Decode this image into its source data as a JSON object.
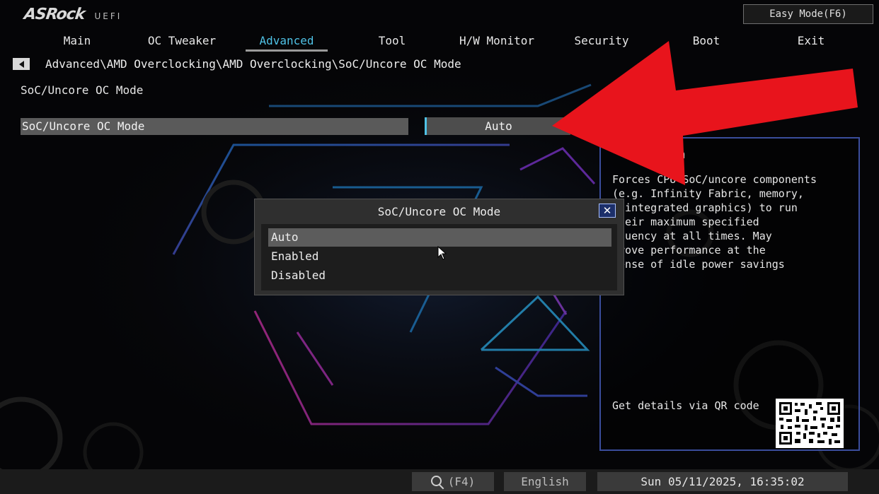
{
  "header": {
    "brand": "ASRock",
    "brand_suffix": "UEFI",
    "easy_mode_label": "Easy Mode(F6)"
  },
  "nav": {
    "items": [
      {
        "label": "Main"
      },
      {
        "label": "OC Tweaker"
      },
      {
        "label": "Advanced",
        "active": true
      },
      {
        "label": "Tool"
      },
      {
        "label": "H/W Monitor"
      },
      {
        "label": "Security"
      },
      {
        "label": "Boot"
      },
      {
        "label": "Exit"
      }
    ]
  },
  "breadcrumb": "Advanced\\AMD Overclocking\\AMD Overclocking\\SoC/Uncore OC Mode",
  "page_title": "SoC/Uncore OC Mode",
  "setting": {
    "label": "SoC/Uncore OC Mode",
    "value": "Auto"
  },
  "description": {
    "title": "tion",
    "lines": [
      "Forces CPU SoC/uncore components",
      "(e.g. Infinity Fabric, memory,",
      "d integrated graphics) to run",
      " their maximum specified",
      "equency at all times. May",
      "prove performance at the",
      "pense of idle power savings"
    ],
    "qr_caption": "Get details via QR code"
  },
  "popup": {
    "title": "SoC/Uncore OC Mode",
    "close_label": "✕",
    "options": [
      {
        "label": "Auto",
        "selected": true
      },
      {
        "label": "Enabled"
      },
      {
        "label": "Disabled"
      }
    ]
  },
  "status_bar": {
    "search_key": "(F4)",
    "language": "English",
    "datetime": "Sun 05/11/2025, 16:35:02"
  },
  "colors": {
    "accent": "#4fc2e6",
    "arrow": "#e8141c",
    "panel_border": "#3a4d9c"
  },
  "icons": [
    "back-arrow-icon",
    "close-icon",
    "search-icon",
    "mouse-cursor-icon",
    "qr-code-icon"
  ]
}
